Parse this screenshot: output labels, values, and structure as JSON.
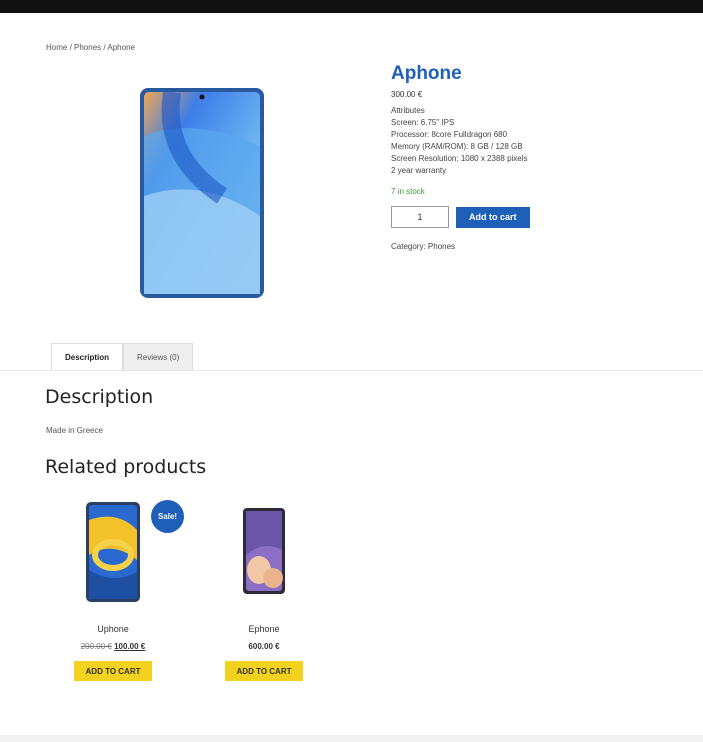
{
  "breadcrumb": {
    "home": "Home",
    "sep1": " / ",
    "category": "Phones",
    "sep2": " / ",
    "current": "Aphone"
  },
  "product": {
    "title": "Aphone",
    "price": "300.00 €",
    "attributes": [
      "Attributes",
      "Screen: 6.75\" IPS",
      "Processor: 8core Fulldragon 680",
      "Memory (RAM/ROM): 8 GB / 128 GB",
      "Screen Resolution: 1080 x 2388 pixels",
      "2 year warranty"
    ],
    "stock": "7 in stock",
    "quantity": "1",
    "add_to_cart": "Add to cart",
    "category": "Category: Phones"
  },
  "tabs": {
    "description": "Description",
    "reviews": "Reviews (0)"
  },
  "description": {
    "heading": "Description",
    "text": "Made in Greece"
  },
  "related": {
    "heading": "Related products",
    "sale_badge": "Sale!",
    "items": [
      {
        "name": "Uphone",
        "old_price": "200.00 €",
        "price": "100.00 €",
        "button": "ADD TO CART"
      },
      {
        "name": "Ephone",
        "price": "600.00 €",
        "button": "ADD TO CART"
      }
    ]
  },
  "colors": {
    "accent": "#1e5fb8",
    "button_yellow": "#f3d21f",
    "stock_green": "#3c9a3c"
  }
}
